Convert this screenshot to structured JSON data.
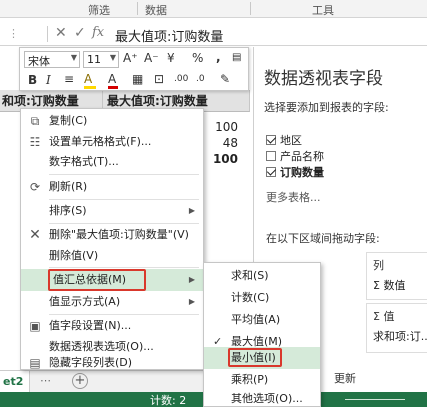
{
  "ribbon": {
    "group1": "筛选",
    "group2": "数据",
    "group3": "工具"
  },
  "formula_bar": {
    "cancel": "✕",
    "enter": "✓",
    "fx": "fx",
    "formula": "最大值项:订购数量"
  },
  "grid": {
    "col_a_header": "和项:订购数量",
    "col_b_header": "最大值项:订购数量",
    "values": [
      "100",
      "48",
      "100"
    ]
  },
  "sheet": {
    "tab": "et2",
    "add": "+"
  },
  "status": {
    "count": "计数: 2"
  },
  "mini_toolbar": {
    "font": "宋体",
    "size": "11",
    "grow": "A⁺",
    "shrink": "A⁻",
    "currency": "¥",
    "percent": "%",
    "comma": ",",
    "bold": "B",
    "italic": "I",
    "fill_letter": "A",
    "font_color_letter": "A"
  },
  "context_menu": {
    "items": [
      {
        "label": "复制(C)",
        "icon": "copy-icon"
      },
      {
        "label": "设置单元格格式(F)...",
        "icon": "format-cells-icon"
      },
      {
        "label": "数字格式(T)...",
        "icon": ""
      },
      {
        "label": "刷新(R)",
        "icon": "refresh-icon"
      },
      {
        "label": "排序(S)",
        "icon": ""
      },
      {
        "label": "删除\"最大值项:订购数量\"(V)",
        "icon": "delete-icon"
      },
      {
        "label": "删除值(V)",
        "icon": ""
      },
      {
        "label": "值汇总依据(M)",
        "icon": ""
      },
      {
        "label": "值显示方式(A)",
        "icon": ""
      },
      {
        "label": "值字段设置(N)...",
        "icon": "field-settings-icon"
      },
      {
        "label": "数据透视表选项(O)...",
        "icon": ""
      },
      {
        "label": "隐藏字段列表(D)",
        "icon": "field-list-icon"
      }
    ]
  },
  "submenu": {
    "items": [
      {
        "label": "求和(S)"
      },
      {
        "label": "计数(C)"
      },
      {
        "label": "平均值(A)"
      },
      {
        "label": "最大值(M)"
      },
      {
        "label": "最小值(I)"
      },
      {
        "label": "乘积(P)"
      },
      {
        "label": "其他选项(O)..."
      }
    ]
  },
  "pivot_panel": {
    "title": "数据透视表字段",
    "subtitle": "选择要添加到报表的字段:",
    "fields": [
      {
        "label": "地区",
        "checked": true
      },
      {
        "label": "产品名称",
        "checked": false
      },
      {
        "label": "订购数量",
        "checked": true
      }
    ],
    "more_tables": "更多表格...",
    "drag_hint": "在以下区域间拖动字段:",
    "columns_label": "列",
    "columns_value": "Σ 数值",
    "values_label": "Σ 值",
    "values_value": "求和项:订...",
    "defer_update": "更新"
  },
  "colors": {
    "excel_green": "#217346",
    "highlight_green": "#d5ead9",
    "red_outline": "#d9382c"
  }
}
